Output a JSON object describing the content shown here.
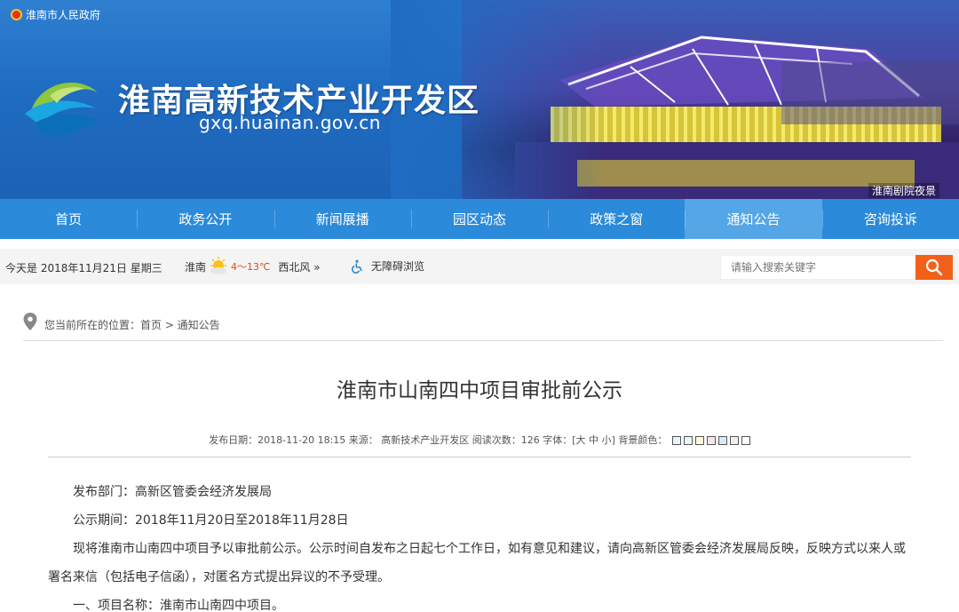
{
  "header": {
    "gov_link": "淮南市人民政府",
    "site_title": "淮南高新技术产业开发区",
    "site_url": "gxq.huainan.gov.cn",
    "photo_caption": "淮南剧院夜景"
  },
  "nav": {
    "items": [
      "首页",
      "政务公开",
      "新闻展播",
      "园区动态",
      "政策之窗",
      "通知公告",
      "咨询投诉"
    ],
    "active": "通知公告"
  },
  "infobar": {
    "date_text": "今天是 2018年11月21日  星期三",
    "city": "淮南",
    "temp": "4～13℃",
    "wind": "西北风 »",
    "accessibility": "无障碍浏览",
    "search_placeholder": "请输入搜索关键字"
  },
  "breadcrumb": {
    "text": "您当前所在的位置：首页 > 通知公告"
  },
  "article": {
    "title": "淮南市山南四中项目审批前公示",
    "meta": "发布日期：2018-11-20 18:15   来源：  高新技术产业开发区    阅读次数：126    字体：[大 中 小]  背景颜色：",
    "bg_colors": [
      "#eaf3fb",
      "#e9f7ee",
      "#fffbd8",
      "#fbe3f0",
      "#dce8f7",
      "#f0f0f0",
      "#ffffff"
    ],
    "paragraphs": [
      "发布部门：高新区管委会经济发展局",
      "公示期间：2018年11月20日至2018年11月28日",
      "现将淮南市山南四中项目予以审批前公示。公示时间自发布之日起七个工作日，如有意见和建议，请向高新区管委会经济发展局反映，反映方式以来人或署名来信（包括电子信函），对匿名方式提出异议的不予受理。",
      "一、项目名称：淮南市山南四中项目。"
    ]
  },
  "colors": {
    "nav_bg": "#2b8ad9",
    "nav_active": "#54a6e6",
    "search_button": "#f2611c"
  }
}
